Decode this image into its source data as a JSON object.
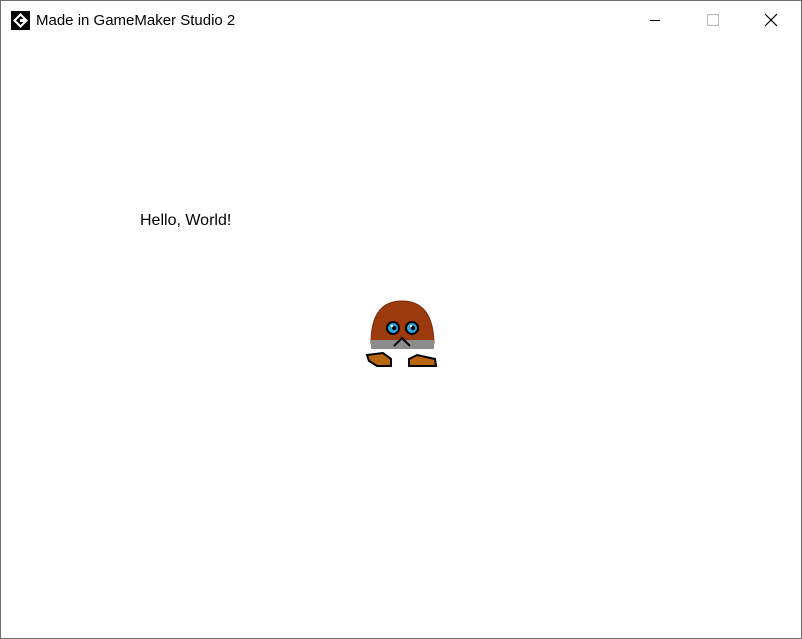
{
  "window": {
    "title": "Made in GameMaker Studio 2",
    "app_icon": "gamemaker-logo-icon",
    "controls": [
      "minimize-icon",
      "maximize-icon",
      "close-icon"
    ]
  },
  "game": {
    "text": "Hello, World!",
    "sprite": "brown-goomba-character",
    "colors": {
      "body": "#9b3a0c",
      "belt": "#8a8a8a",
      "feet": "#b8650f",
      "eyes": "#29a8e6",
      "outline": "#000000"
    }
  }
}
